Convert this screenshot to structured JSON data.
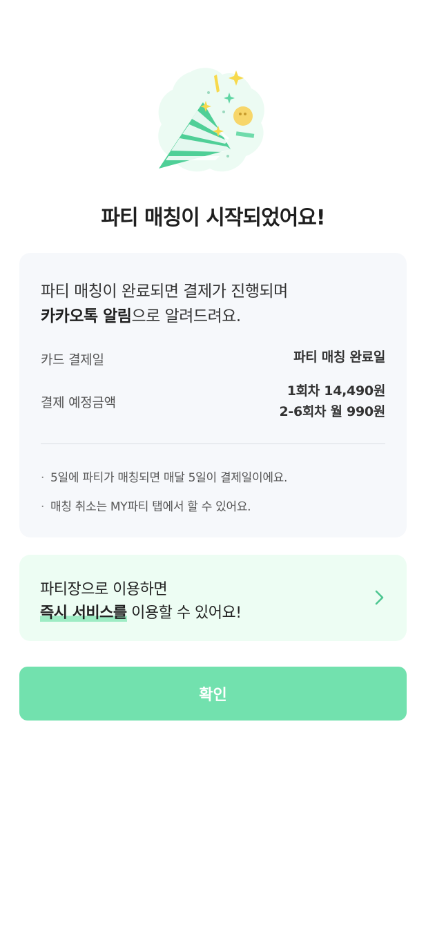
{
  "title": "파티 매칭이 시작되었어요!",
  "info": {
    "desc_line1": "파티 매칭이 완료되면 결제가 진행되며",
    "desc_strong": "카카오톡 알림",
    "desc_rest": "으로 알려드려요.",
    "rows": [
      {
        "label": "카드 결제일",
        "values": [
          "파티 매칭 완료일"
        ]
      },
      {
        "label": "결제 예정금액",
        "values": [
          "1회차 14,490원",
          "2-6회차 월 990원"
        ]
      }
    ],
    "notes": [
      "5일에 파티가 매칭되면 매달 5일이 결제일이에요.",
      "매칭 취소는 MY파티 탭에서 할 수 있어요."
    ]
  },
  "promo": {
    "line1": "파티장으로 이용하면",
    "highlight": "즉시 서비스를",
    "line2_rest": " 이용할 수 있어요!"
  },
  "confirm_label": "확인",
  "colors": {
    "accent": "#72e1ae",
    "promo_bg": "#edfdf3",
    "card_bg": "#f6f8fb"
  }
}
